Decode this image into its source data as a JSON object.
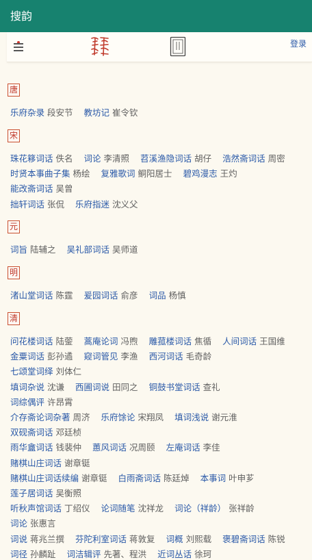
{
  "app": {
    "title": "搜韵"
  },
  "toolbar": {
    "login_label": "登录",
    "icons": [
      "menu-icon",
      "seal-logo-icon",
      "book-icon"
    ]
  },
  "sections": [
    {
      "dynasty": "唐",
      "rows": [
        [
          {
            "title": "乐府杂录",
            "author": "段安节"
          },
          {
            "title": "教坊记",
            "author": "崔令钦"
          }
        ]
      ]
    },
    {
      "dynasty": "宋",
      "rows": [
        [
          {
            "title": "珠花簃词话",
            "author": "佚名"
          },
          {
            "title": "词论",
            "author": "李清照"
          },
          {
            "title": "苕溪渔隐词话",
            "author": "胡仔"
          },
          {
            "title": "浩然斋词话",
            "author": "周密"
          }
        ],
        [
          {
            "title": "时贤本事曲子集",
            "author": "杨绘"
          },
          {
            "title": "复雅歌词",
            "author": "鲖阳居士"
          },
          {
            "title": "碧鸡漫志",
            "author": "王灼"
          }
        ],
        [
          {
            "title": "能改斋词话",
            "author": "吴曾"
          }
        ],
        [
          {
            "title": "拙轩词话",
            "author": "张侃"
          },
          {
            "title": "乐府指迷",
            "author": "沈义父"
          }
        ]
      ]
    },
    {
      "dynasty": "元",
      "rows": [
        [
          {
            "title": "词旨",
            "author": "陆辅之"
          },
          {
            "title": "吴礼部词话",
            "author": "吴师道"
          }
        ]
      ]
    },
    {
      "dynasty": "明",
      "rows": [
        [
          {
            "title": "渚山堂词话",
            "author": "陈霆"
          },
          {
            "title": "爰园词话",
            "author": "俞彦"
          },
          {
            "title": "词品",
            "author": "杨慎"
          }
        ]
      ]
    },
    {
      "dynasty": "清",
      "rows": [
        [
          {
            "title": "问花楼词话",
            "author": "陆蓥"
          },
          {
            "title": "蒿庵论词",
            "author": "冯煦"
          },
          {
            "title": "雕菰楼词话",
            "author": "焦循"
          },
          {
            "title": "人间词话",
            "author": "王国维"
          }
        ],
        [
          {
            "title": "金粟词话",
            "author": "彭孙遹"
          },
          {
            "title": "窥词管见",
            "author": "李渔"
          },
          {
            "title": "西河词话",
            "author": "毛奇龄"
          }
        ],
        [
          {
            "title": "七颂堂词绎",
            "author": "刘体仁"
          }
        ],
        [
          {
            "title": "填词杂说",
            "author": "沈谦"
          },
          {
            "title": "西圃词说",
            "author": "田同之"
          },
          {
            "title": "铜鼓书堂词话",
            "author": "查礼"
          }
        ],
        [
          {
            "title": "词综偶评",
            "author": "许昂霄"
          }
        ],
        [
          {
            "title": "介存斋论词杂著",
            "author": "周济"
          },
          {
            "title": "乐府馀论",
            "author": "宋翔凤"
          },
          {
            "title": "填词浅说",
            "author": "谢元淮"
          }
        ],
        [
          {
            "title": "双砚斋词话",
            "author": "邓廷桢"
          }
        ],
        [
          {
            "title": "雨华盦词话",
            "author": "钱裴仲"
          },
          {
            "title": "蕙风词话",
            "author": "况周颐"
          },
          {
            "title": "左庵词话",
            "author": "李佳"
          }
        ],
        [
          {
            "title": "赌棋山庄词话",
            "author": "谢章铤"
          }
        ],
        [
          {
            "title": "赌棋山庄词话续编",
            "author": "谢章铤"
          },
          {
            "title": "白雨斋词话",
            "author": "陈廷焯"
          },
          {
            "title": "本事词",
            "author": "叶申芗"
          }
        ],
        [
          {
            "title": "莲子居词话",
            "author": "吴衡照"
          }
        ],
        [
          {
            "title": "听秋声馆词话",
            "author": "丁绍仪"
          },
          {
            "title": "论词随笔",
            "author": "沈祥龙"
          },
          {
            "title": "词论（祥龄）",
            "author": "张祥龄"
          }
        ],
        [
          {
            "title": "词论",
            "author": "张惠言"
          }
        ],
        [
          {
            "title": "词说",
            "author": "蒋兆兰撰"
          },
          {
            "title": "芬陀利室词话",
            "author": "蒋敦复"
          },
          {
            "title": "词概",
            "author": "刘熙载"
          },
          {
            "title": "褒碧斋词话",
            "author": "陈锐"
          }
        ],
        [
          {
            "title": "词径",
            "author": "孙麟趾"
          },
          {
            "title": "词洁辑评",
            "author": "先著、程洪"
          },
          {
            "title": "近词丛话",
            "author": "徐珂"
          }
        ]
      ]
    }
  ]
}
